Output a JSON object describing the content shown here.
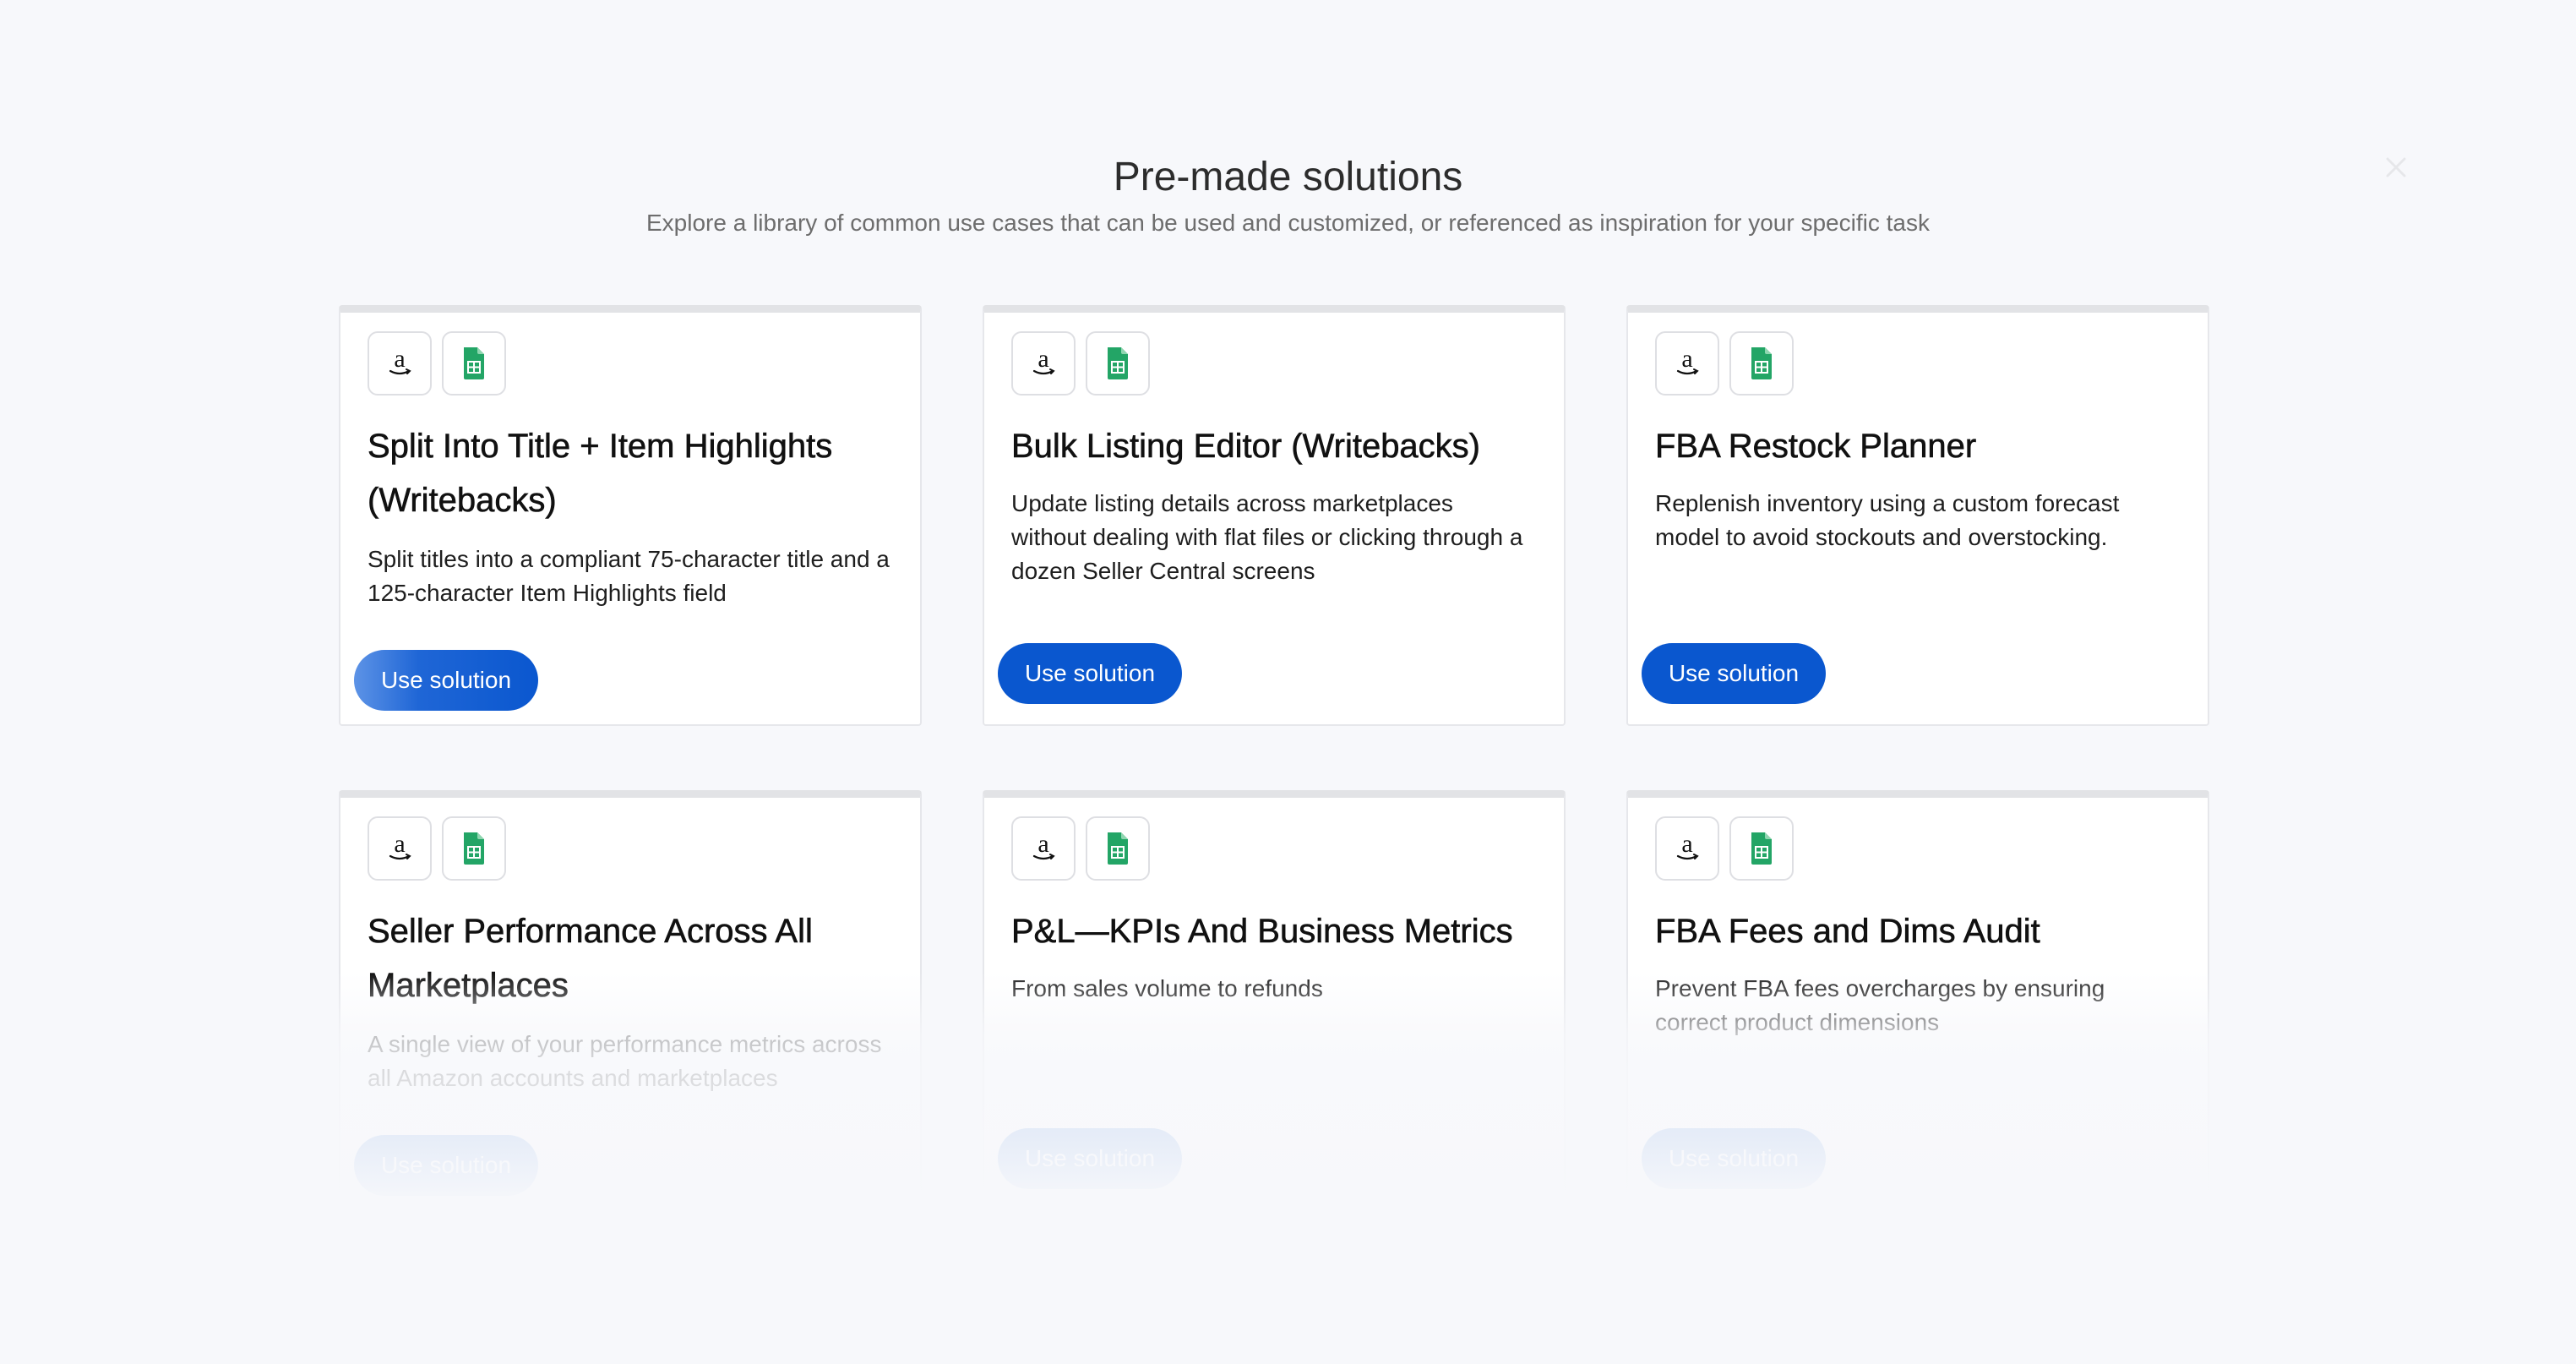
{
  "header": {
    "title": "Pre-made solutions",
    "subtitle": "Explore a library of common use cases that can be used and customized, or referenced as inspiration for your specific task"
  },
  "colors": {
    "accent": "#0a57cf",
    "background": "#f7f8fb",
    "sheets_green": "#23a566",
    "amazon_orange": "#e8940c"
  },
  "icons": [
    "amazon-icon",
    "google-sheets-icon",
    "close-icon"
  ],
  "button_label": "Use solution",
  "cards": [
    {
      "title": "Split Into Title + Item Highlights (Writebacks)",
      "description": "Split titles into a compliant 75-character title and a 125-character Item Highlights field",
      "button": "Use solution"
    },
    {
      "title": "Bulk Listing Editor (Writebacks)",
      "description": "Update listing details across marketplaces without dealing with flat files or clicking through a dozen Seller Central screens",
      "button": "Use solution"
    },
    {
      "title": "FBA Restock Planner",
      "description": "Replenish inventory using a custom forecast model to avoid stockouts and overstocking.",
      "button": "Use solution"
    },
    {
      "title": "Seller Performance Across All Marketplaces",
      "description": "A single view of your performance metrics across all Amazon accounts and marketplaces",
      "button": "Use solution"
    },
    {
      "title": "P&L—KPIs And Business Metrics",
      "description": "From sales volume to refunds",
      "button": "Use solution"
    },
    {
      "title": "FBA Fees and Dims Audit",
      "description": "Prevent FBA fees overcharges by ensuring correct product dimensions",
      "button": "Use solution"
    }
  ]
}
